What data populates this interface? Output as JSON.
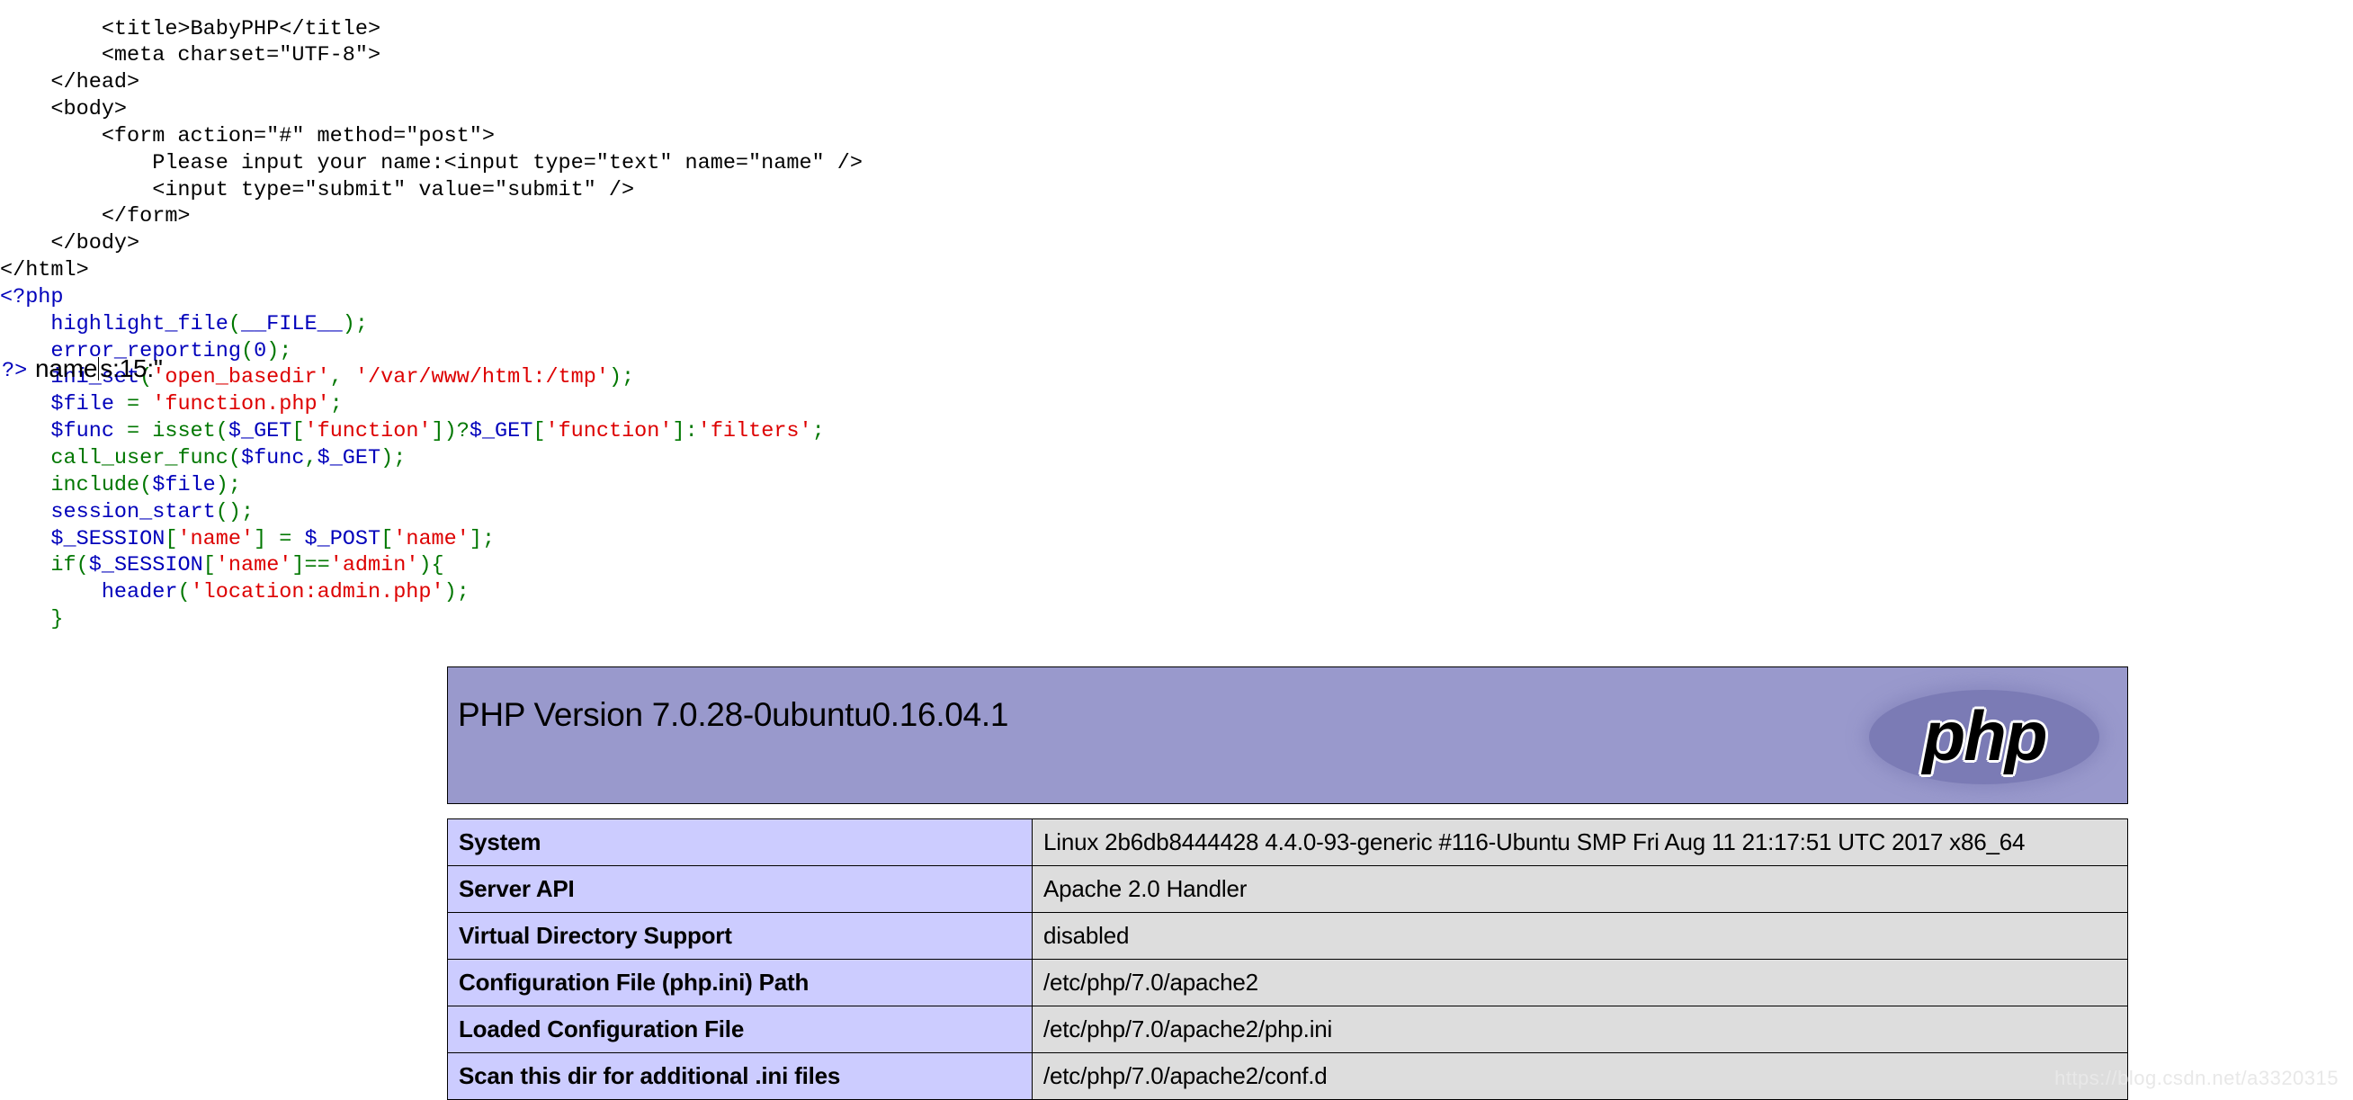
{
  "source_code": {
    "language": "php",
    "lines": [
      [
        {
          "t": "        <title>BabyPHP</title>",
          "c": "html"
        }
      ],
      [
        {
          "t": "        <meta charset=\"UTF-8\">",
          "c": "html"
        }
      ],
      [
        {
          "t": "    </head>",
          "c": "html"
        }
      ],
      [
        {
          "t": "    <body>",
          "c": "html"
        }
      ],
      [
        {
          "t": "        <form action=\"#\" method=\"post\">",
          "c": "html"
        }
      ],
      [
        {
          "t": "            Please input your name:<input type=\"text\" name=\"name\" />",
          "c": "html"
        }
      ],
      [
        {
          "t": "            <input type=\"submit\" value=\"submit\" />",
          "c": "html"
        }
      ],
      [
        {
          "t": "        </form>",
          "c": "html"
        }
      ],
      [
        {
          "t": "    </body>",
          "c": "html"
        }
      ],
      [
        {
          "t": "</html>",
          "c": "html"
        }
      ],
      [
        {
          "t": "<?php",
          "c": "key"
        }
      ],
      [
        {
          "t": "    ",
          "c": "html"
        },
        {
          "t": "highlight_file",
          "c": "key"
        },
        {
          "t": "(",
          "c": "fn"
        },
        {
          "t": "__FILE__",
          "c": "key"
        },
        {
          "t": ");",
          "c": "fn"
        }
      ],
      [
        {
          "t": "    ",
          "c": "html"
        },
        {
          "t": "error_reporting",
          "c": "key"
        },
        {
          "t": "(",
          "c": "fn"
        },
        {
          "t": "0",
          "c": "key"
        },
        {
          "t": ");",
          "c": "fn"
        }
      ],
      [
        {
          "t": "    ",
          "c": "html"
        },
        {
          "t": "ini_set",
          "c": "key"
        },
        {
          "t": "(",
          "c": "fn"
        },
        {
          "t": "'open_basedir'",
          "c": "str"
        },
        {
          "t": ", ",
          "c": "fn"
        },
        {
          "t": "'/var/www/html:/tmp'",
          "c": "str"
        },
        {
          "t": ");",
          "c": "fn"
        }
      ],
      [
        {
          "t": "    ",
          "c": "html"
        },
        {
          "t": "$file",
          "c": "key"
        },
        {
          "t": " = ",
          "c": "fn"
        },
        {
          "t": "'function.php'",
          "c": "str"
        },
        {
          "t": ";",
          "c": "fn"
        }
      ],
      [
        {
          "t": "    ",
          "c": "html"
        },
        {
          "t": "$func",
          "c": "key"
        },
        {
          "t": " = ",
          "c": "fn"
        },
        {
          "t": "isset",
          "c": "fn"
        },
        {
          "t": "(",
          "c": "fn"
        },
        {
          "t": "$_GET",
          "c": "key"
        },
        {
          "t": "[",
          "c": "fn"
        },
        {
          "t": "'function'",
          "c": "str"
        },
        {
          "t": "])?",
          "c": "fn"
        },
        {
          "t": "$_GET",
          "c": "key"
        },
        {
          "t": "[",
          "c": "fn"
        },
        {
          "t": "'function'",
          "c": "str"
        },
        {
          "t": "]:",
          "c": "fn"
        },
        {
          "t": "'filters'",
          "c": "str"
        },
        {
          "t": ";",
          "c": "fn"
        }
      ],
      [
        {
          "t": "    ",
          "c": "html"
        },
        {
          "t": "call_user_func",
          "c": "fn"
        },
        {
          "t": "(",
          "c": "fn"
        },
        {
          "t": "$func",
          "c": "key"
        },
        {
          "t": ",",
          "c": "fn"
        },
        {
          "t": "$_GET",
          "c": "key"
        },
        {
          "t": ");",
          "c": "fn"
        }
      ],
      [
        {
          "t": "    ",
          "c": "html"
        },
        {
          "t": "include",
          "c": "fn"
        },
        {
          "t": "(",
          "c": "fn"
        },
        {
          "t": "$file",
          "c": "key"
        },
        {
          "t": ");",
          "c": "fn"
        }
      ],
      [
        {
          "t": "    ",
          "c": "html"
        },
        {
          "t": "session_start",
          "c": "key"
        },
        {
          "t": "();",
          "c": "fn"
        }
      ],
      [
        {
          "t": "    ",
          "c": "html"
        },
        {
          "t": "$_SESSION",
          "c": "key"
        },
        {
          "t": "[",
          "c": "fn"
        },
        {
          "t": "'name'",
          "c": "str"
        },
        {
          "t": "] = ",
          "c": "fn"
        },
        {
          "t": "$_POST",
          "c": "key"
        },
        {
          "t": "[",
          "c": "fn"
        },
        {
          "t": "'name'",
          "c": "str"
        },
        {
          "t": "];",
          "c": "fn"
        }
      ],
      [
        {
          "t": "    ",
          "c": "html"
        },
        {
          "t": "if",
          "c": "fn"
        },
        {
          "t": "(",
          "c": "fn"
        },
        {
          "t": "$_SESSION",
          "c": "key"
        },
        {
          "t": "[",
          "c": "fn"
        },
        {
          "t": "'name'",
          "c": "str"
        },
        {
          "t": "]==",
          "c": "fn"
        },
        {
          "t": "'admin'",
          "c": "str"
        },
        {
          "t": "){",
          "c": "fn"
        }
      ],
      [
        {
          "t": "        ",
          "c": "html"
        },
        {
          "t": "header",
          "c": "key"
        },
        {
          "t": "(",
          "c": "fn"
        },
        {
          "t": "'location:admin.php'",
          "c": "str"
        },
        {
          "t": ");",
          "c": "fn"
        }
      ],
      [
        {
          "t": "    ",
          "c": "html"
        },
        {
          "t": "}",
          "c": "fn"
        }
      ]
    ]
  },
  "form_output": {
    "php_close_tag": "?>",
    "text_before_caret": "name",
    "text_after_caret": "s:15:\""
  },
  "phpinfo": {
    "banner": {
      "version_label": "PHP Version 7.0.28-0ubuntu0.16.04.1",
      "logo_text": "php",
      "background_color": "#9999cc",
      "logo_ellipse_color": "#7b7bb5"
    },
    "table": {
      "key_background": "#ccccff",
      "value_background": "#dddddd",
      "rows": [
        {
          "key": "System",
          "value": "Linux 2b6db8444428 4.4.0-93-generic #116-Ubuntu SMP Fri Aug 11 21:17:51 UTC 2017 x86_64"
        },
        {
          "key": "Server API",
          "value": "Apache 2.0 Handler"
        },
        {
          "key": "Virtual Directory Support",
          "value": "disabled"
        },
        {
          "key": "Configuration File (php.ini) Path",
          "value": "/etc/php/7.0/apache2"
        },
        {
          "key": "Loaded Configuration File",
          "value": "/etc/php/7.0/apache2/php.ini"
        },
        {
          "key": "Scan this dir for additional .ini files",
          "value": "/etc/php/7.0/apache2/conf.d"
        }
      ]
    }
  },
  "watermark": {
    "text": "https://blog.csdn.net/a3320315"
  }
}
